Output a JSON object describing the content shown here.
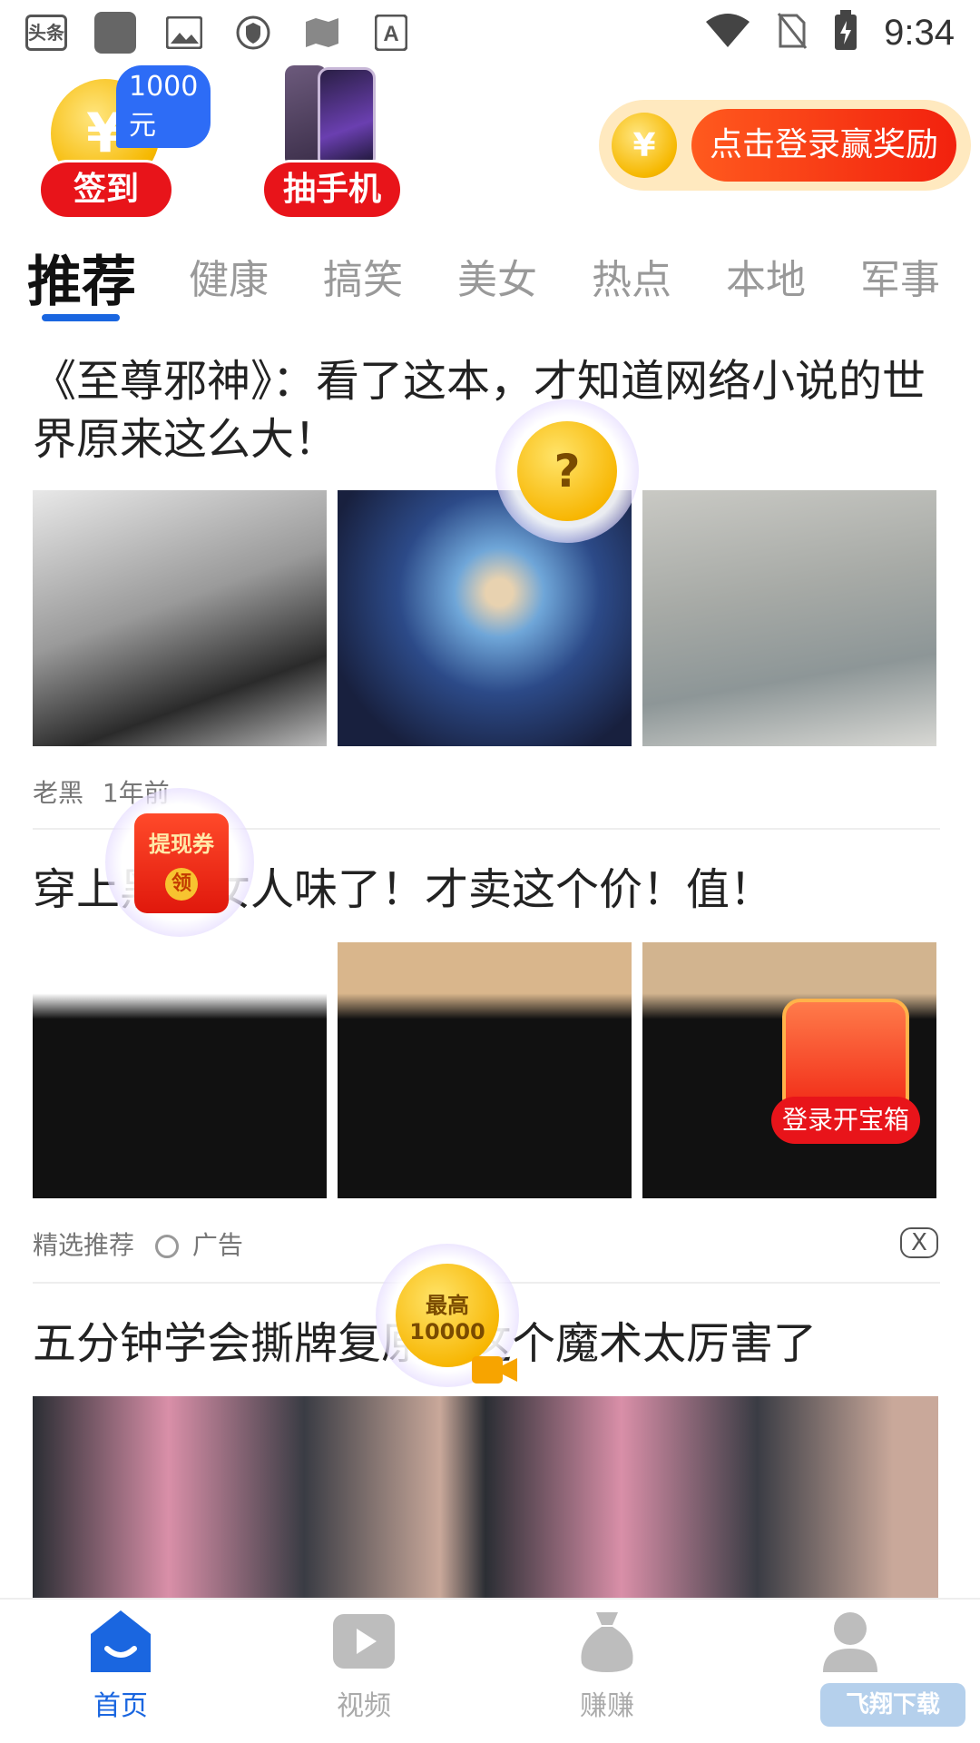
{
  "status_bar": {
    "app_badge": "头条",
    "time": "9:34"
  },
  "promo": {
    "signin_label": "签到",
    "signin_badge": "1000元",
    "phone_label": "抽手机",
    "login_label": "点击登录赢奖励"
  },
  "tabs": [
    "推荐",
    "健康",
    "搞笑",
    "美女",
    "热点",
    "本地",
    "军事"
  ],
  "feed": [
    {
      "title": "《至尊邪神》：看了这本，才知道网络小说的世界原来这么大！",
      "author": "老黑",
      "time": "1年前"
    },
    {
      "title": "穿上黑有女人味了！才卖这个价！值！",
      "source": "精选推荐",
      "ad_label": "广告",
      "close": "X"
    },
    {
      "title": "五分钟学会撕牌复原，这个魔术太厉害了"
    }
  ],
  "floating": {
    "question_coin": "?",
    "withdraw_coupon": "提现券",
    "withdraw_claim": "领",
    "treasure_label": "登录开宝箱",
    "max_label": "最高",
    "max_value": "10000"
  },
  "bottom_nav": [
    "首页",
    "视频",
    "赚赚",
    ""
  ],
  "watermark": "飞翔下载",
  "colors": {
    "accent": "#1a66e0",
    "red": "#e8141a",
    "coin": "#f6b800"
  }
}
